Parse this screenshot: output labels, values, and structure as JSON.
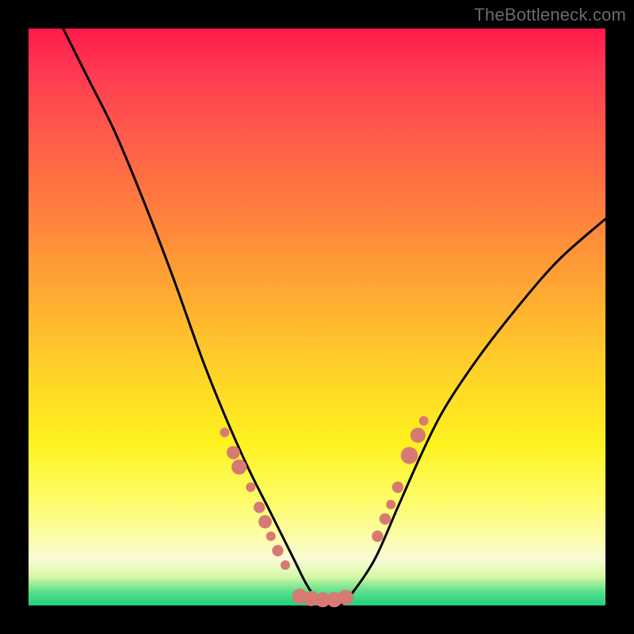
{
  "watermark": "TheBottleneck.com",
  "colors": {
    "frame": "#000000",
    "curve": "#000000",
    "marker": "#d87a74"
  },
  "chart_data": {
    "type": "line",
    "title": "",
    "xlabel": "",
    "ylabel": "",
    "xlim": [
      0,
      100
    ],
    "ylim": [
      0,
      100
    ],
    "grid": false,
    "series": [
      {
        "name": "bottleneck-curve",
        "x": [
          6,
          10,
          15,
          20,
          25,
          30,
          34,
          38,
          42,
          46,
          48,
          50,
          52,
          54,
          56,
          60,
          64,
          68,
          72,
          78,
          85,
          92,
          100
        ],
        "y": [
          100,
          92,
          82,
          70,
          57,
          43,
          33,
          24,
          16,
          8,
          4,
          1,
          0,
          0,
          2,
          8,
          17,
          26,
          34,
          43,
          52,
          60,
          67
        ]
      }
    ],
    "markers": [
      {
        "x": 34.0,
        "y": 30.0,
        "r": 1.0
      },
      {
        "x": 35.5,
        "y": 26.5,
        "r": 1.4
      },
      {
        "x": 36.5,
        "y": 24.0,
        "r": 1.6
      },
      {
        "x": 38.5,
        "y": 20.5,
        "r": 1.0
      },
      {
        "x": 40.0,
        "y": 17.0,
        "r": 1.2
      },
      {
        "x": 41.0,
        "y": 14.5,
        "r": 1.4
      },
      {
        "x": 42.0,
        "y": 12.0,
        "r": 1.0
      },
      {
        "x": 43.2,
        "y": 9.5,
        "r": 1.2
      },
      {
        "x": 44.5,
        "y": 7.0,
        "r": 1.0
      },
      {
        "x": 47.0,
        "y": 1.6,
        "r": 1.6
      },
      {
        "x": 49.0,
        "y": 1.2,
        "r": 1.6
      },
      {
        "x": 51.0,
        "y": 1.0,
        "r": 1.6
      },
      {
        "x": 53.0,
        "y": 1.0,
        "r": 1.6
      },
      {
        "x": 55.0,
        "y": 1.4,
        "r": 1.6
      },
      {
        "x": 60.5,
        "y": 12.0,
        "r": 1.2
      },
      {
        "x": 61.8,
        "y": 15.0,
        "r": 1.2
      },
      {
        "x": 62.8,
        "y": 17.5,
        "r": 1.0
      },
      {
        "x": 64.0,
        "y": 20.5,
        "r": 1.2
      },
      {
        "x": 66.0,
        "y": 26.0,
        "r": 1.8
      },
      {
        "x": 67.5,
        "y": 29.5,
        "r": 1.6
      },
      {
        "x": 68.5,
        "y": 32.0,
        "r": 1.0
      }
    ]
  }
}
